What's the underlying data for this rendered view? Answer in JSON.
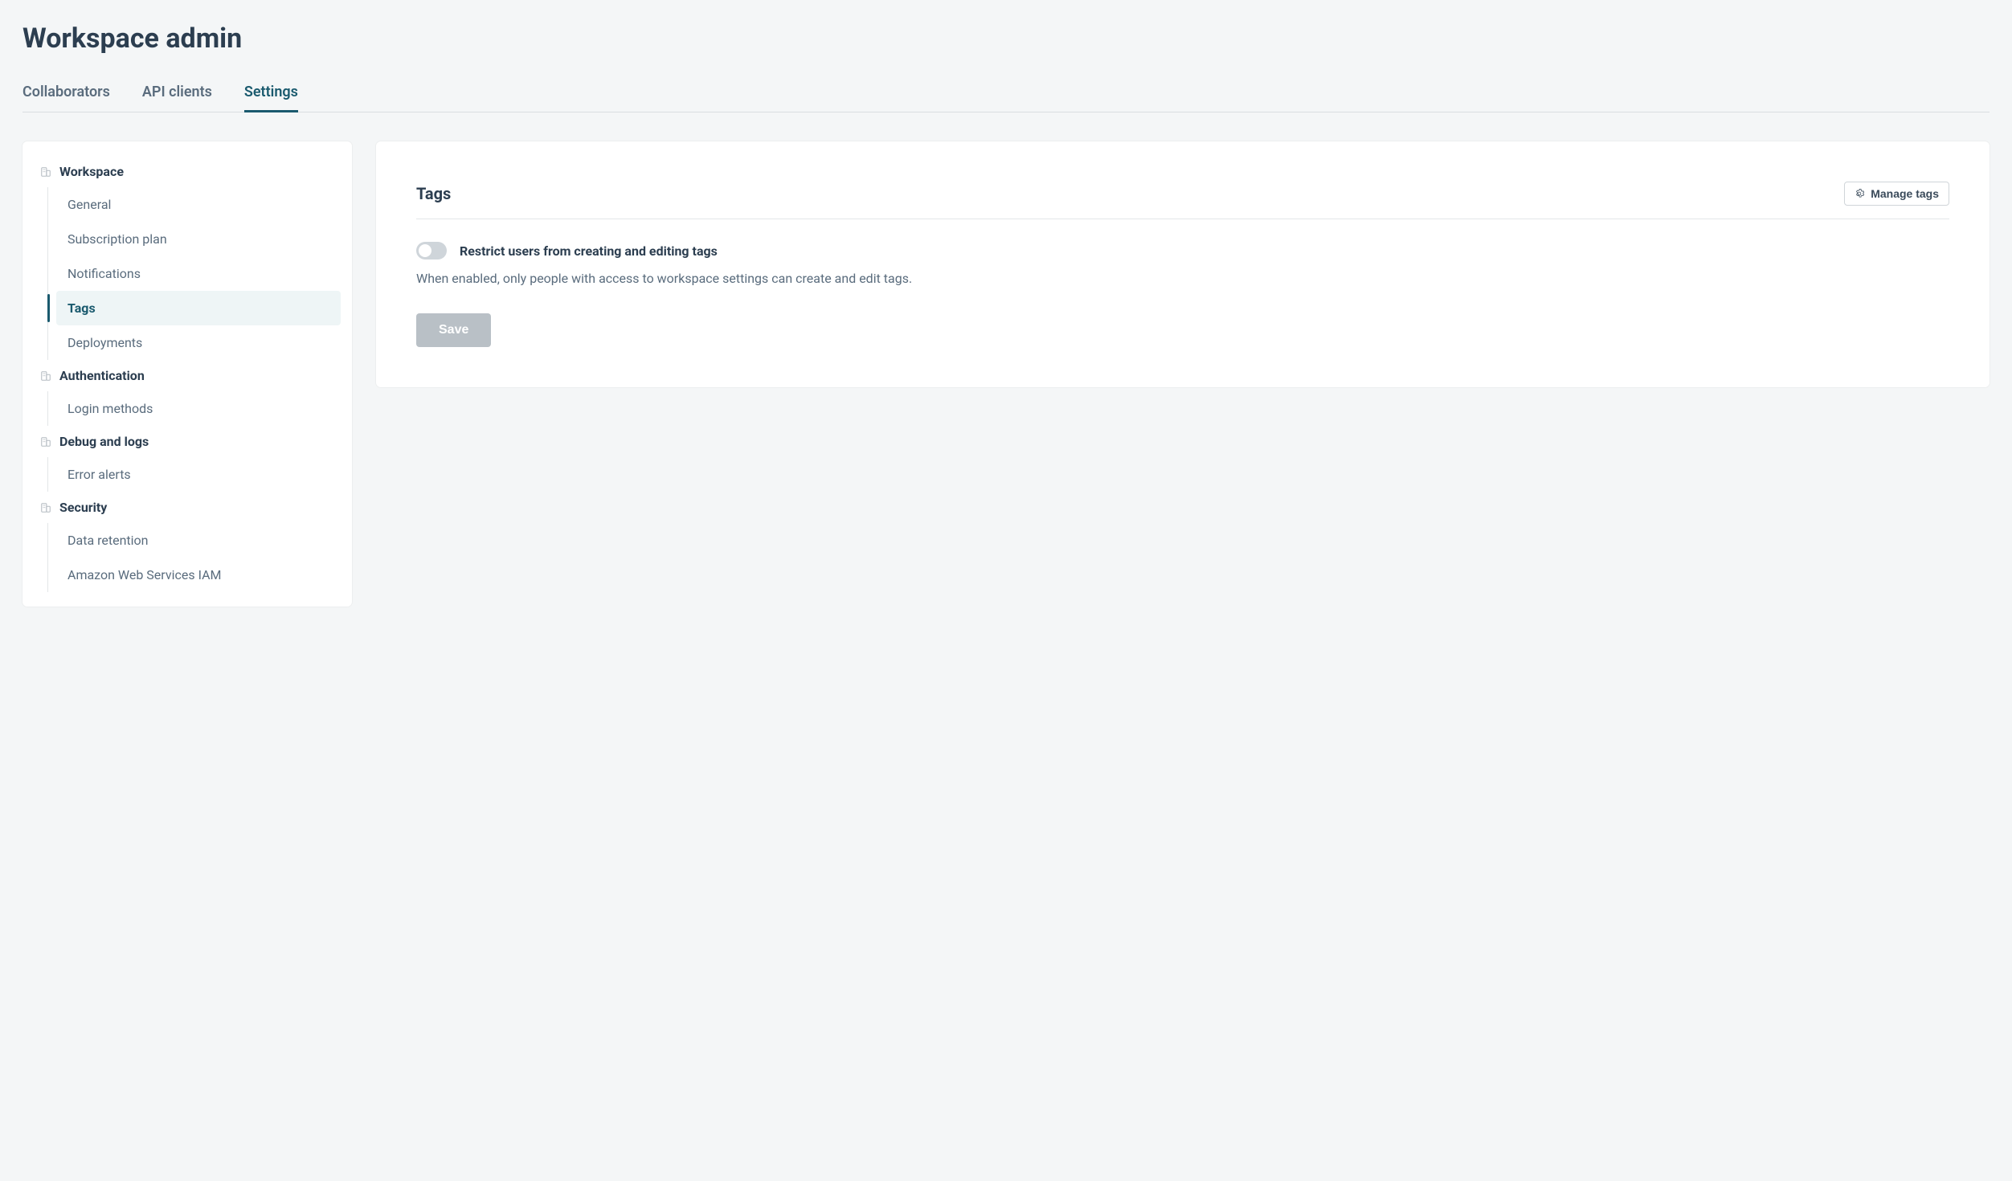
{
  "page_title": "Workspace admin",
  "tabs": [
    {
      "label": "Collaborators",
      "active": false
    },
    {
      "label": "API clients",
      "active": false
    },
    {
      "label": "Settings",
      "active": true
    }
  ],
  "sidebar": {
    "sections": [
      {
        "label": "Workspace",
        "items": [
          {
            "label": "General",
            "active": false
          },
          {
            "label": "Subscription plan",
            "active": false
          },
          {
            "label": "Notifications",
            "active": false
          },
          {
            "label": "Tags",
            "active": true
          },
          {
            "label": "Deployments",
            "active": false
          }
        ]
      },
      {
        "label": "Authentication",
        "items": [
          {
            "label": "Login methods",
            "active": false
          }
        ]
      },
      {
        "label": "Debug and logs",
        "items": [
          {
            "label": "Error alerts",
            "active": false
          }
        ]
      },
      {
        "label": "Security",
        "items": [
          {
            "label": "Data retention",
            "active": false
          },
          {
            "label": "Amazon Web Services IAM",
            "active": false
          }
        ]
      }
    ]
  },
  "panel": {
    "title": "Tags",
    "manage_button_label": "Manage tags",
    "toggle_label": "Restrict users from creating and editing tags",
    "toggle_enabled": false,
    "toggle_description": "When enabled, only people with access to workspace settings can create and edit tags.",
    "save_button_label": "Save",
    "save_button_enabled": false
  }
}
